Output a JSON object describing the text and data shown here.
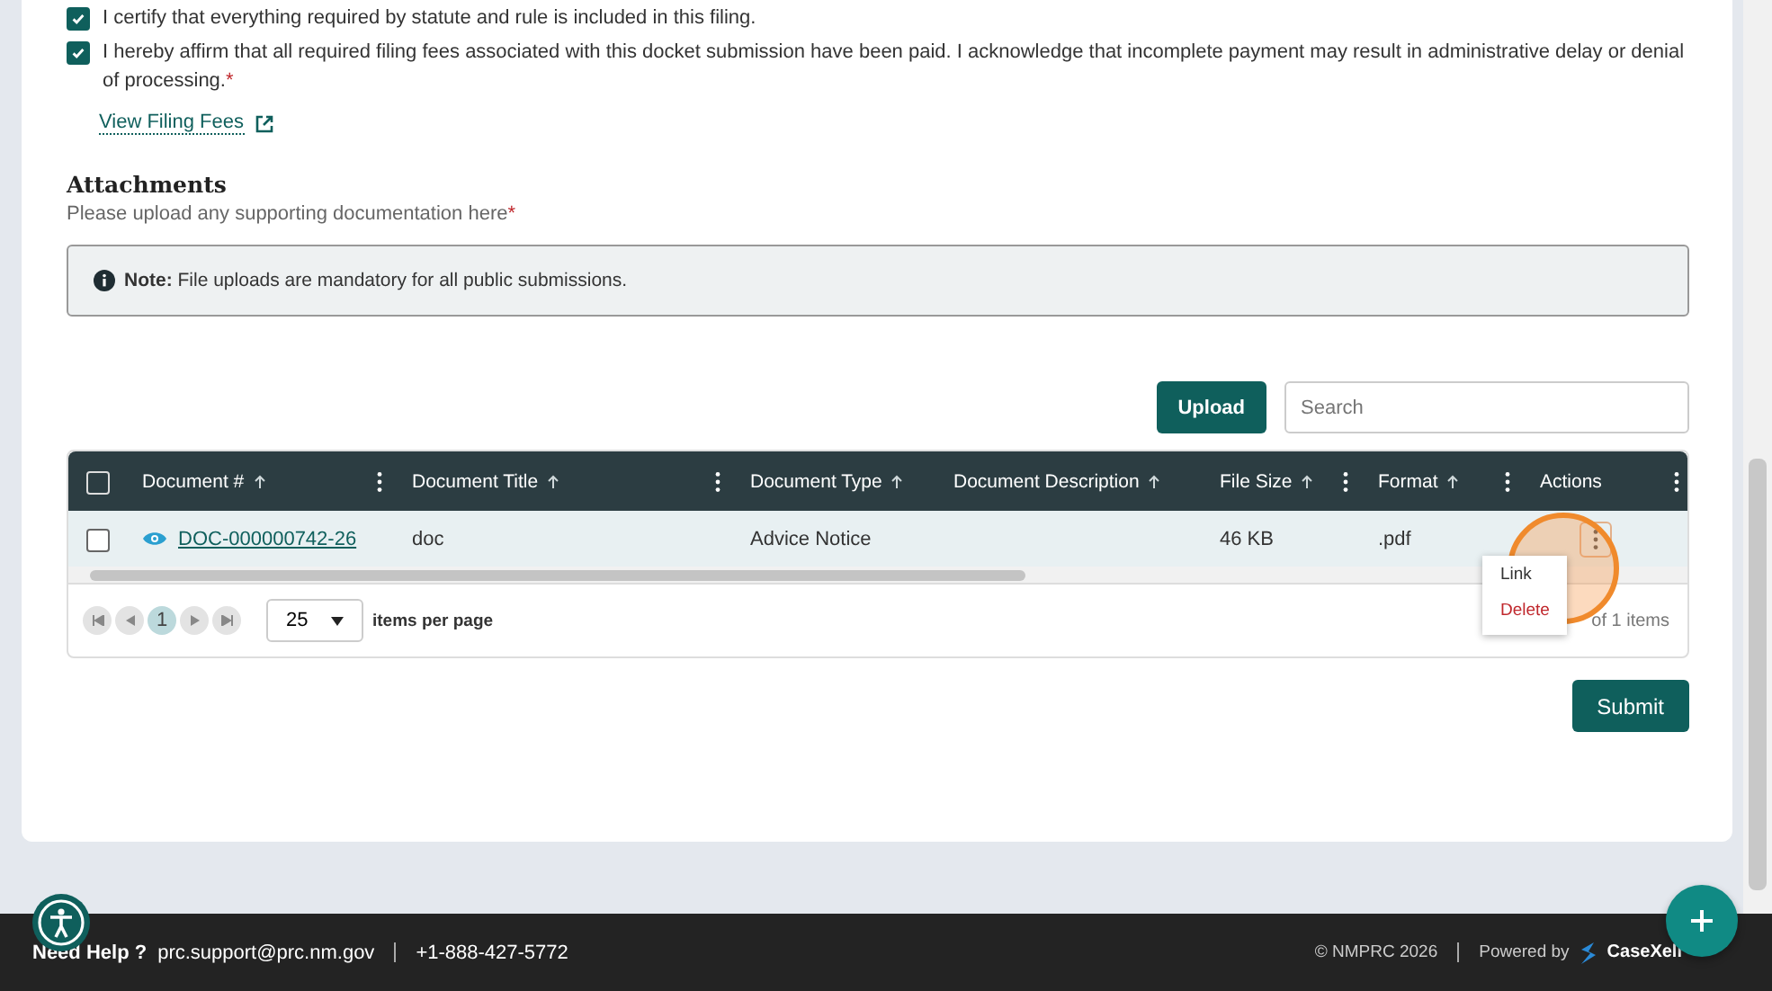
{
  "certifications": [
    {
      "text": "I certify that everything required by statute and rule is included in this filing.",
      "checked": true
    },
    {
      "text": "I hereby affirm that all required filing fees associated with this docket submission have been paid. I acknowledge that incomplete payment may result in administrative delay or denial of processing.",
      "required_mark": "*",
      "checked": true
    }
  ],
  "fees_link": "View Filing Fees",
  "attachments": {
    "title": "Attachments",
    "hint": "Please upload any supporting documentation here",
    "required_mark": "*",
    "note_label": "Note:",
    "note_text": "File uploads are mandatory for all public submissions."
  },
  "upload_button": "Upload",
  "search": {
    "placeholder": "Search"
  },
  "table": {
    "header_checked": false,
    "columns": [
      {
        "label": "Document #",
        "sortable": true,
        "menu": true
      },
      {
        "label": "Document Title",
        "sortable": true,
        "menu": true
      },
      {
        "label": "Document Type",
        "sortable": true,
        "menu": false
      },
      {
        "label": "Document Description",
        "sortable": true,
        "menu": false
      },
      {
        "label": "File Size",
        "sortable": true,
        "menu": true
      },
      {
        "label": "Format",
        "sortable": true,
        "menu": true
      },
      {
        "label": "Actions",
        "sortable": false,
        "menu": true
      }
    ],
    "rows": [
      {
        "checked": false,
        "document_number": "DOC-000000742-26",
        "title": "doc",
        "type": "Advice Notice",
        "size": "46 KB",
        "format": ".pdf"
      }
    ]
  },
  "pager": {
    "pages": [
      {
        "label": "1",
        "selected": true
      }
    ],
    "page_size": "25",
    "per_page_label": "items per page",
    "summary": "of 1 items"
  },
  "row_menu": {
    "items": [
      {
        "label": "Link",
        "kind": "normal"
      },
      {
        "label": "Delete",
        "kind": "danger"
      }
    ]
  },
  "submit_button": "Submit",
  "footer": {
    "help_label": "Need Help ?",
    "email": "prc.support@prc.nm.gov",
    "phone": "+1-888-427-5772",
    "copyright": "© NMPRC 2026",
    "powered_by": "Powered by",
    "brand": "CaseXell"
  }
}
